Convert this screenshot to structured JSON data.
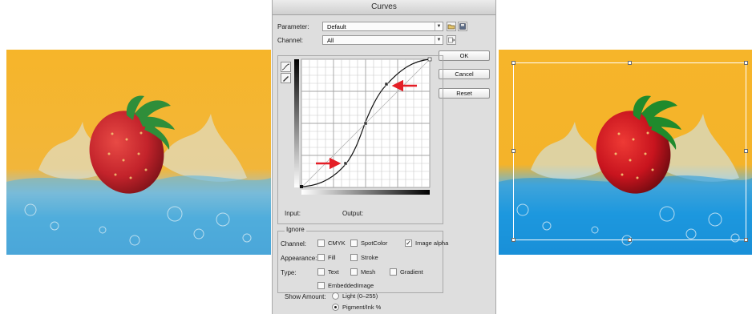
{
  "dialog": {
    "title": "Curves",
    "parameter": {
      "label": "Parameter:",
      "value": "Default"
    },
    "channel": {
      "label": "Channel:",
      "value": "All"
    },
    "buttons": {
      "ok": "OK",
      "cancel": "Cancel",
      "reset": "Reset"
    },
    "input_label": "Input:",
    "output_label": "Output:",
    "ignore": {
      "legend": "Ignore",
      "channel_label": "Channel:",
      "appearance_label": "Appearance:",
      "type_label": "Type:",
      "options": {
        "cmyk": {
          "label": "CMYK",
          "checked": false
        },
        "spotcolor": {
          "label": "SpotColor",
          "checked": false
        },
        "image_alpha": {
          "label": "Image alpha",
          "checked": true
        },
        "fill": {
          "label": "Fill",
          "checked": false
        },
        "stroke": {
          "label": "Stroke",
          "checked": false
        },
        "text": {
          "label": "Text",
          "checked": false
        },
        "mesh": {
          "label": "Mesh",
          "checked": false
        },
        "gradient": {
          "label": "Gradient",
          "checked": false
        },
        "embedded_image": {
          "label": "EmbeddedImage",
          "checked": false
        }
      }
    },
    "show_amount": {
      "label": "Show Amount:",
      "light": "Light (0–255)",
      "pigment": "Pigment/Ink %",
      "selected": "pigment"
    }
  },
  "icons": {
    "open": "folder-open-icon",
    "save": "save-icon",
    "channel_extra": "channel-options-icon",
    "curve_tool": "curve-tool-icon",
    "pencil_tool": "pencil-tool-icon"
  },
  "colors": {
    "background_orange": "#f6b52a",
    "water_blue": "#3fa8dc",
    "strawberry_red": "#c3232b",
    "arrow_red": "#e41e26",
    "dialog_gray": "#dedede"
  }
}
